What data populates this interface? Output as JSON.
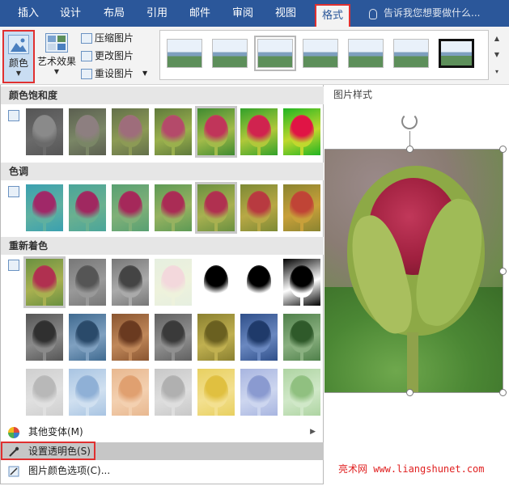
{
  "tabs": [
    {
      "label": "插入",
      "active": false
    },
    {
      "label": "设计",
      "active": false
    },
    {
      "label": "布局",
      "active": false
    },
    {
      "label": "引用",
      "active": false
    },
    {
      "label": "邮件",
      "active": false
    },
    {
      "label": "审阅",
      "active": false
    },
    {
      "label": "视图",
      "active": false
    },
    {
      "label": "格式",
      "active": true
    }
  ],
  "tell_me": "告诉我您想要做什么...",
  "ribbon": {
    "color_label": "颜色",
    "art_effects_label": "艺术效果",
    "compress_label": "压缩图片",
    "change_label": "更改图片",
    "reset_label": "重设图片",
    "style_count": 7
  },
  "pane_label": "图片样式",
  "panel": {
    "saturation_title": "颜色饱和度",
    "tone_title": "色调",
    "recolor_title": "重新着色",
    "more_variants": "其他变体(M)",
    "set_transparent": "设置透明色(S)",
    "color_options": "图片颜色选项(C)..."
  },
  "watermark": "亮术网 www.liangshunet.com",
  "colors": {
    "word_blue": "#2b579a",
    "highlight_red": "#e03030",
    "menu_hover": "#c6c6c6"
  }
}
